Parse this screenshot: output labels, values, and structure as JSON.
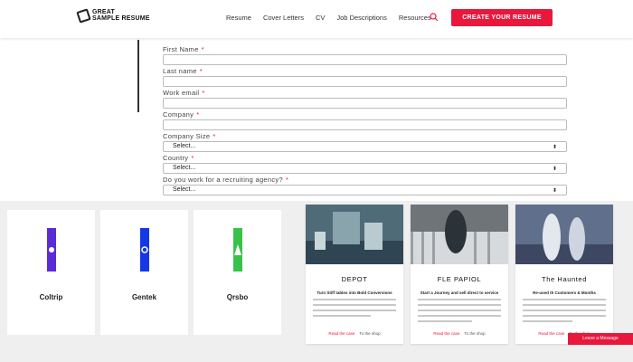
{
  "header": {
    "logo_line1": "GREAT",
    "logo_line2": "SAMPLE RESUME",
    "nav": [
      "Resume",
      "Cover Letters",
      "CV",
      "Job Descriptions",
      "Resources"
    ],
    "cta_label": "CREATE YOUR RESUME",
    "accent": "#e8173c"
  },
  "form": {
    "fields": [
      {
        "label": "First Name",
        "value": ""
      },
      {
        "label": "Last name",
        "value": ""
      },
      {
        "label": "Work email",
        "value": ""
      },
      {
        "label": "Company",
        "value": ""
      },
      {
        "label": "Company Size",
        "value": "Select..."
      },
      {
        "label": "Country",
        "value": "Select..."
      },
      {
        "label": "Do you work for a recruiting agency?",
        "value": "Select..."
      }
    ],
    "required_marker": "*"
  },
  "logo_cards": [
    {
      "caption": "Coltrip",
      "color": "#5b2bd6"
    },
    {
      "caption": "Gentek",
      "color": "#1537e6"
    },
    {
      "caption": "Qrsbo",
      "color": "#39c24a"
    }
  ],
  "case_cards": [
    {
      "title": "DEPOT",
      "subtitle": "Turn Stiff tables into Bold Conversions",
      "links": [
        "Read the case",
        "To the shop"
      ]
    },
    {
      "title": "FLE PAPIOL",
      "subtitle": "Start a Journey and sell direct to service",
      "links": [
        "Read the case",
        "To the shop"
      ]
    },
    {
      "title": "The Haunted",
      "subtitle": "Re-used th Customers & Months",
      "links": [
        "Read the case",
        "To the shop"
      ]
    }
  ],
  "chat_label": "Leave a Message"
}
